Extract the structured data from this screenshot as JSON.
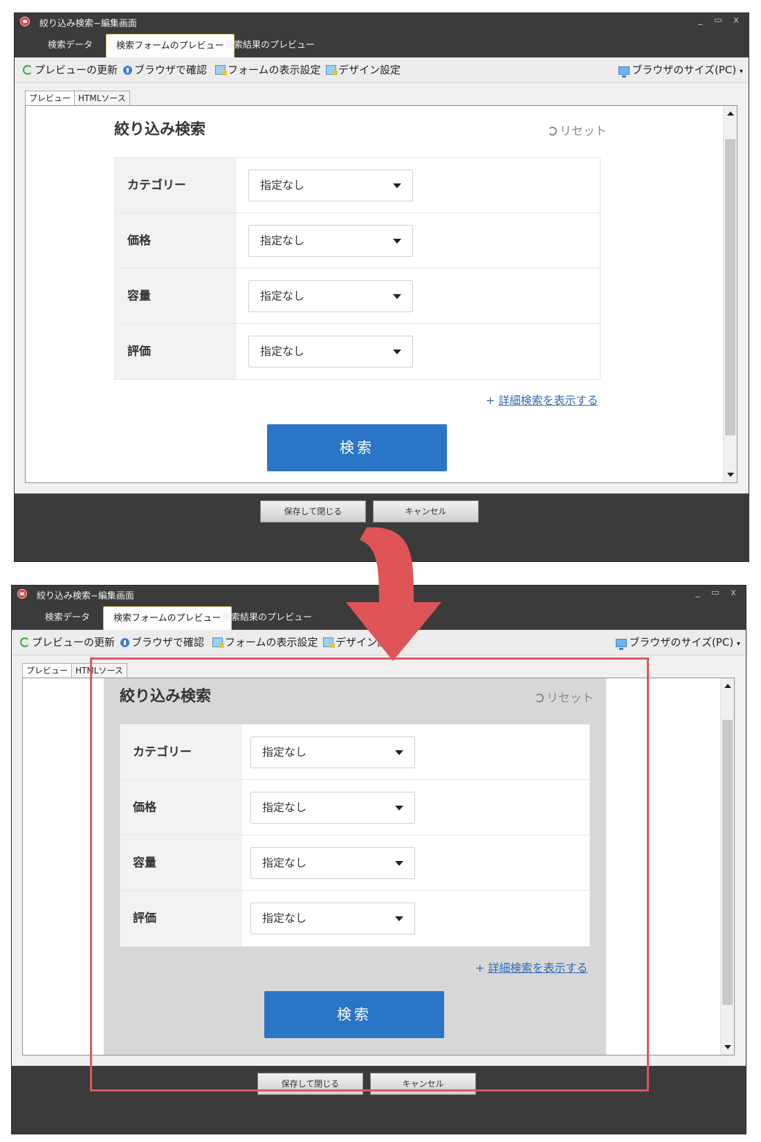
{
  "window": {
    "title": "絞り込み検索−編集画面",
    "controls": [
      "_",
      "▭",
      "x"
    ]
  },
  "tabs": [
    {
      "label": "検索データ",
      "active": false
    },
    {
      "label": "検索フォームのプレビュー",
      "active": true
    },
    {
      "label": "検索結果のプレビュー",
      "active": false
    }
  ],
  "toolbar": {
    "refresh": "プレビューの更新",
    "browser_check": "ブラウザで確認",
    "form_settings": "フォームの表示設定",
    "design_settings": "デザイン設定",
    "browser_size": "ブラウザのサイズ(PC)"
  },
  "sub_tabs": [
    "プレビュー",
    "HTMLソース"
  ],
  "form": {
    "title": "絞り込み検索",
    "reset": "リセット",
    "fields": [
      {
        "label": "カテゴリー",
        "value": "指定なし"
      },
      {
        "label": "価格",
        "value": "指定なし"
      },
      {
        "label": "容量",
        "value": "指定なし"
      },
      {
        "label": "評価",
        "value": "指定なし"
      }
    ],
    "detail_prefix": "+",
    "detail_link": "詳細検索を表示する",
    "search_button": "検索"
  },
  "footer": {
    "save_close": "保存して閉じる",
    "cancel": "キャンセル"
  },
  "colors": {
    "accent_button": "#2b75c7",
    "highlight": "#d9585b",
    "window_chrome": "#3b3b3b"
  }
}
